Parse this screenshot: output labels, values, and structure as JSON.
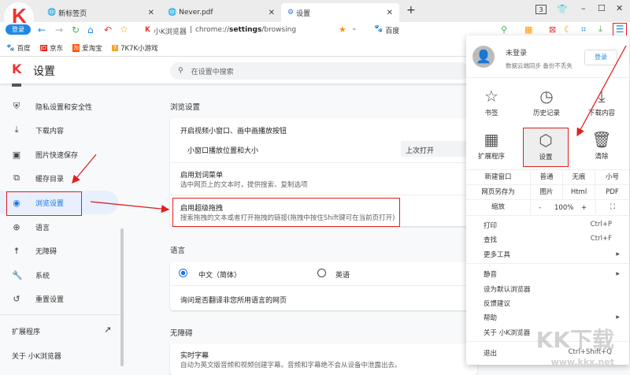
{
  "tabs": [
    {
      "label": "新标签页"
    },
    {
      "label": "Never.pdf"
    },
    {
      "label": "设置",
      "active": true
    }
  ],
  "window": {
    "tab_count": "3"
  },
  "login_badge": "登录",
  "address": {
    "site": "小K浏览器",
    "separator": "|",
    "url_prefix": "chrome://",
    "url_bold": "settings",
    "url_suffix": "/browsing",
    "search_engine": "百度"
  },
  "bookmarks": [
    {
      "label": "百度"
    },
    {
      "label": "京东"
    },
    {
      "label": "爱淘宝"
    },
    {
      "label": "7K7K小游戏"
    }
  ],
  "settings": {
    "title": "设置",
    "search_placeholder": "在设置中搜索",
    "sidebar": [
      {
        "label": "隐私设置和安全性",
        "icon": "shield-icon"
      },
      {
        "label": "下载内容",
        "icon": "download-icon"
      },
      {
        "label": "图片快速保存",
        "icon": "image-icon"
      },
      {
        "label": "缓存目录",
        "icon": "cache-icon"
      },
      {
        "label": "浏览设置",
        "icon": "eye-icon",
        "active": true
      },
      {
        "label": "语言",
        "icon": "globe-icon"
      },
      {
        "label": "无障碍",
        "icon": "accessibility-icon"
      },
      {
        "label": "系统",
        "icon": "wrench-icon"
      },
      {
        "label": "重置设置",
        "icon": "history-icon"
      }
    ],
    "extensions": "扩展程序",
    "about": "关于 小K浏览器",
    "browsing": {
      "heading": "浏览设置",
      "pip": "开启视频小窗口、画中画播放按钮",
      "pip_pos": "小窗口播放位置和大小",
      "pip_pos_value": "上次打开",
      "word_menu": "启用划词菜单",
      "word_menu_desc": "选中网页上的文本时，提供搜索、复制选项",
      "super_drag": "启用超级拖拽",
      "super_drag_desc": "搜索拖拽的文本或者打开拖拽的链接(拖拽中按住Shift键可在当前页打开)"
    },
    "language": {
      "heading": "语言",
      "opt1": "中文（简体）",
      "opt2": "英语",
      "translate": "询问是否翻译非您所用语言的网页"
    },
    "accessibility": {
      "heading": "无障碍",
      "captions": "实时字幕",
      "captions_desc": "自动为英文版音频和视频创建字幕。音频和字幕绝不会从设备中泄露出去。"
    }
  },
  "menu": {
    "user": "未登录",
    "user_desc": "数据云端同步 备份不丢失",
    "login": "登录",
    "grid": [
      {
        "label": "书签"
      },
      {
        "label": "历史记录"
      },
      {
        "label": "下载内容"
      },
      {
        "label": "扩展程序"
      },
      {
        "label": "设置"
      },
      {
        "label": "清除"
      }
    ],
    "new_window": {
      "label": "新建窗口",
      "opts": [
        "普通",
        "无痕",
        "小号"
      ]
    },
    "save_as": {
      "label": "网页另存为",
      "opts": [
        "图片",
        "Html",
        "PDF"
      ]
    },
    "zoom": {
      "label": "缩放",
      "minus": "-",
      "value": "100%",
      "plus": "+"
    },
    "items1": [
      {
        "label": "打印",
        "shortcut": "Ctrl+P"
      },
      {
        "label": "查找",
        "shortcut": "Ctrl+F"
      },
      {
        "label": "更多工具",
        "sub": true
      }
    ],
    "items2": [
      {
        "label": "静音",
        "sub": true
      },
      {
        "label": "设为默认浏览器"
      },
      {
        "label": "反馈建议"
      },
      {
        "label": "帮助",
        "sub": true
      },
      {
        "label": "关于 小K浏览器"
      }
    ],
    "exit": {
      "label": "退出",
      "shortcut": "Ctrl+Shift+Q"
    }
  },
  "watermark": {
    "logo": "KK下载",
    "url": "www.kkx.net"
  },
  "colors": {
    "accent": "#1a73e8",
    "annotation": "#e02020"
  }
}
